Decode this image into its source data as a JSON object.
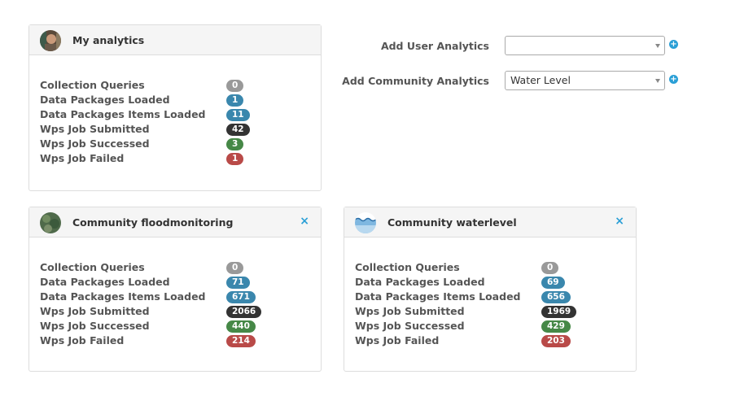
{
  "panels": [
    {
      "title": "My analytics",
      "avatar": "user-photo",
      "closable": false,
      "stats": [
        {
          "label": "Collection Queries",
          "value": "0",
          "color": "#999999"
        },
        {
          "label": "Data Packages Loaded",
          "value": "1",
          "color": "#3a87ad"
        },
        {
          "label": "Data Packages Items Loaded",
          "value": "11",
          "color": "#3a87ad"
        },
        {
          "label": "Wps Job Submitted",
          "value": "42",
          "color": "#333333"
        },
        {
          "label": "Wps Job Successed",
          "value": "3",
          "color": "#468847"
        },
        {
          "label": "Wps Job Failed",
          "value": "1",
          "color": "#b94a48"
        }
      ]
    },
    {
      "title": "Community floodmonitoring",
      "avatar": "community-floodmonitoring-image",
      "closable": true,
      "close_glyph": "×",
      "stats": [
        {
          "label": "Collection Queries",
          "value": "0",
          "color": "#999999"
        },
        {
          "label": "Data Packages Loaded",
          "value": "71",
          "color": "#3a87ad"
        },
        {
          "label": "Data Packages Items Loaded",
          "value": "671",
          "color": "#3a87ad"
        },
        {
          "label": "Wps Job Submitted",
          "value": "2066",
          "color": "#333333"
        },
        {
          "label": "Wps Job Successed",
          "value": "440",
          "color": "#468847"
        },
        {
          "label": "Wps Job Failed",
          "value": "214",
          "color": "#b94a48"
        }
      ]
    },
    {
      "title": "Community waterlevel",
      "avatar": "community-waterlevel-image",
      "closable": true,
      "close_glyph": "×",
      "stats": [
        {
          "label": "Collection Queries",
          "value": "0",
          "color": "#999999"
        },
        {
          "label": "Data Packages Loaded",
          "value": "69",
          "color": "#3a87ad"
        },
        {
          "label": "Data Packages Items Loaded",
          "value": "656",
          "color": "#3a87ad"
        },
        {
          "label": "Wps Job Submitted",
          "value": "1969",
          "color": "#333333"
        },
        {
          "label": "Wps Job Successed",
          "value": "429",
          "color": "#468847"
        },
        {
          "label": "Wps Job Failed",
          "value": "203",
          "color": "#b94a48"
        }
      ]
    }
  ],
  "add_user": {
    "label": "Add User Analytics",
    "selected": "",
    "icon": "add-circle-icon"
  },
  "add_community": {
    "label": "Add Community Analytics",
    "selected": "Water Level",
    "icon": "add-circle-icon"
  },
  "colors": {
    "accent": "#2a9fd6",
    "panel_header": "#f5f5f5",
    "border": "#dddddd"
  }
}
